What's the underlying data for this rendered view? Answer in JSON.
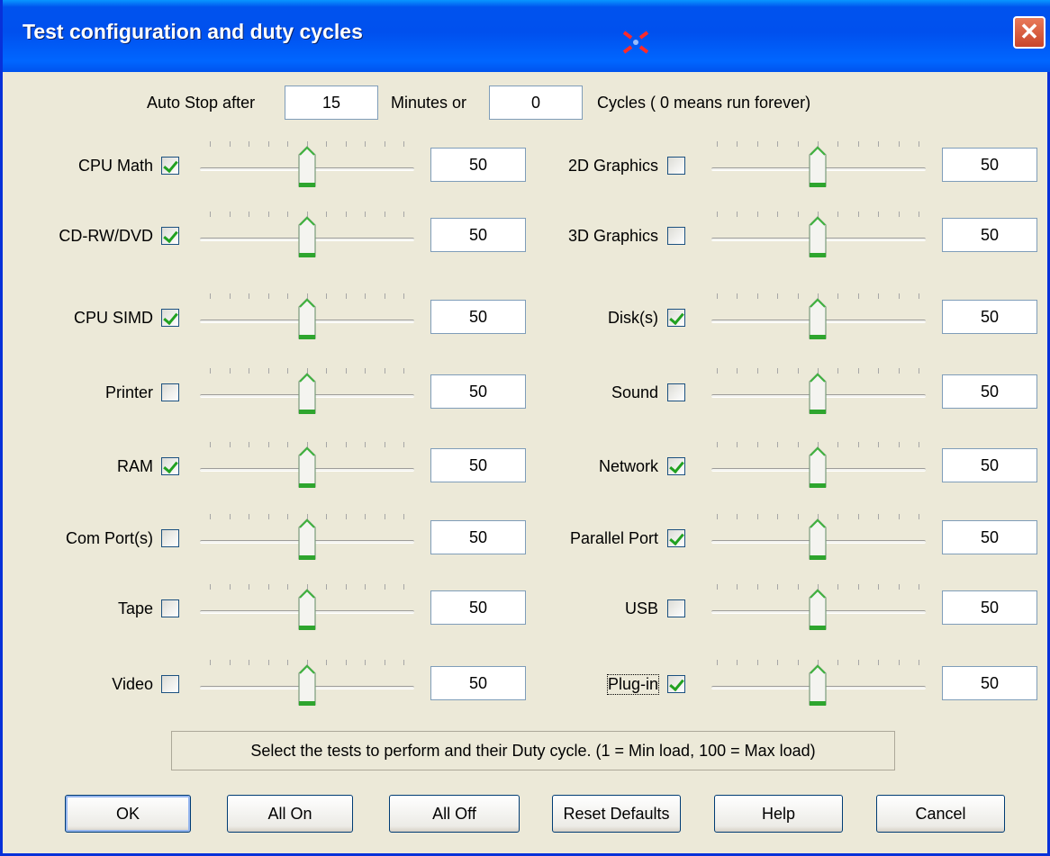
{
  "window": {
    "title": "Test configuration and duty cycles",
    "close_glyph": "✕"
  },
  "autostop": {
    "prefix": "Auto Stop after",
    "minutes_value": "15",
    "minutes_label": "Minutes or",
    "cycles_value": "0",
    "cycles_label": "Cycles ( 0 means run forever)"
  },
  "tests": [
    {
      "label": "CPU Math",
      "checked": true,
      "value": "50",
      "level": 50
    },
    {
      "label": "CD-RW/DVD",
      "checked": true,
      "value": "50",
      "level": 50
    },
    {
      "label": "CPU SIMD",
      "checked": true,
      "value": "50",
      "level": 50
    },
    {
      "label": "Printer",
      "checked": false,
      "value": "50",
      "level": 50
    },
    {
      "label": "RAM",
      "checked": true,
      "value": "50",
      "level": 50
    },
    {
      "label": "Com Port(s)",
      "checked": false,
      "value": "50",
      "level": 50
    },
    {
      "label": "Tape",
      "checked": false,
      "value": "50",
      "level": 50
    },
    {
      "label": "Video",
      "checked": false,
      "value": "50",
      "level": 50
    },
    {
      "label": "2D Graphics",
      "checked": false,
      "value": "50",
      "level": 50
    },
    {
      "label": "3D Graphics",
      "checked": false,
      "value": "50",
      "level": 50
    },
    {
      "label": "Disk(s)",
      "checked": true,
      "value": "50",
      "level": 50
    },
    {
      "label": "Sound",
      "checked": false,
      "value": "50",
      "level": 50
    },
    {
      "label": "Network",
      "checked": true,
      "value": "50",
      "level": 50
    },
    {
      "label": "Parallel Port",
      "checked": true,
      "value": "50",
      "level": 50
    },
    {
      "label": "USB",
      "checked": false,
      "value": "50",
      "level": 50
    },
    {
      "label": "Plug-in",
      "checked": true,
      "value": "50",
      "level": 50
    }
  ],
  "status_text": "Select the tests to perform and their Duty cycle. (1 = Min load, 100 = Max load)",
  "buttons": {
    "ok": "OK",
    "all_on": "All On",
    "all_off": "All Off",
    "reset": "Reset Defaults",
    "help": "Help",
    "cancel": "Cancel"
  }
}
